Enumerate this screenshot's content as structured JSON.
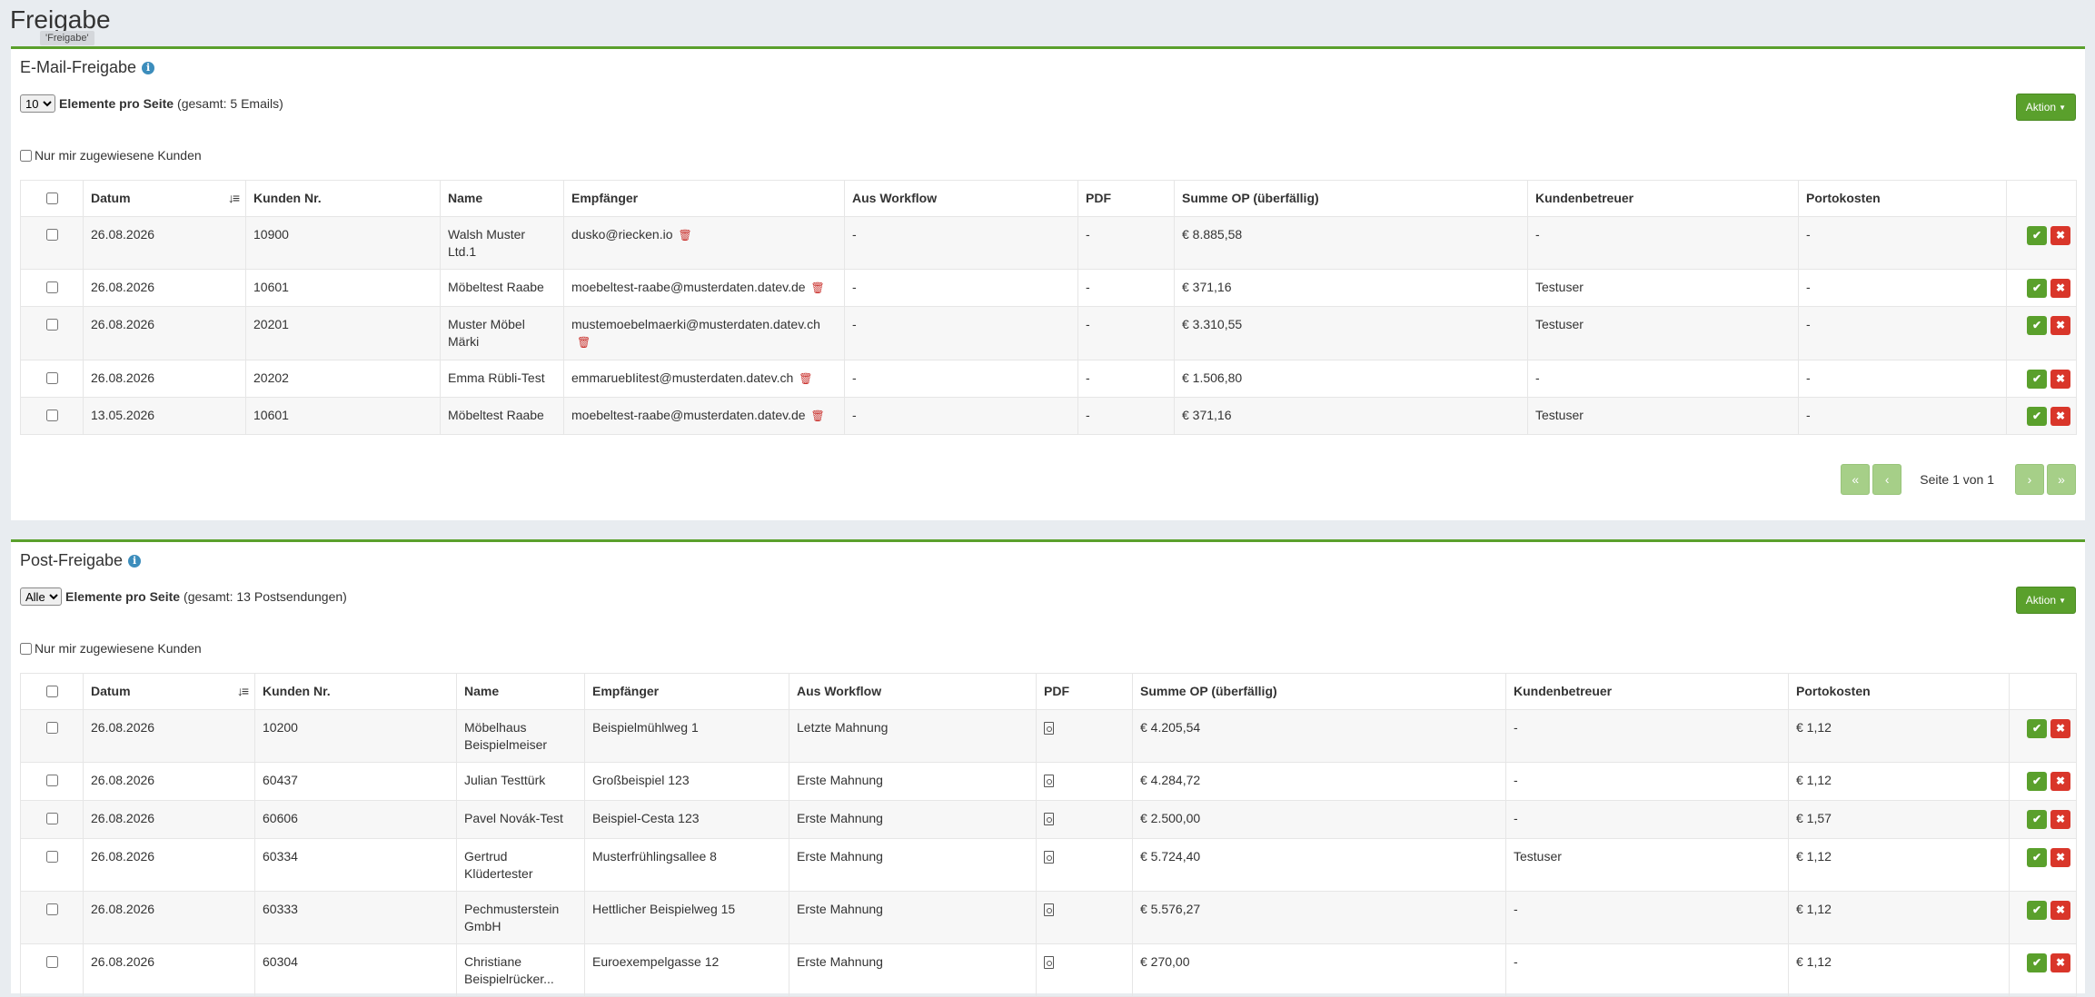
{
  "page": {
    "title": "Freigabe",
    "tooltip": "'Freigabe'"
  },
  "email": {
    "title": "E-Mail-Freigabe",
    "perpage_value": "10",
    "perpage_label": "Elemente pro Seite",
    "total": "(gesamt: 5 Emails)",
    "aktion": "Aktion",
    "mine_label": "Nur mir zugewiesene Kunden",
    "columns": [
      "Datum",
      "Kunden Nr.",
      "Name",
      "Empfänger",
      "Aus Workflow",
      "PDF",
      "Summe OP (überfällig)",
      "Kundenbetreuer",
      "Portokosten"
    ],
    "rows": [
      {
        "datum": "26.08.2026",
        "nr": "10900",
        "name": "Walsh Muster Ltd.1",
        "empf": "dusko@riecken.io",
        "workflow": "-",
        "pdf": "-",
        "summe": "€ 8.885,58",
        "betreuer": "-",
        "porto": "-"
      },
      {
        "datum": "26.08.2026",
        "nr": "10601",
        "name": "Möbeltest Raabe",
        "empf": "moebeltest-raabe@musterdaten.datev.de",
        "workflow": "-",
        "pdf": "-",
        "summe": "€ 371,16",
        "betreuer": "Testuser",
        "porto": "-"
      },
      {
        "datum": "26.08.2026",
        "nr": "20201",
        "name": "Muster Möbel Märki",
        "empf": "mustemoebelmaerki@musterdaten.datev.ch",
        "workflow": "-",
        "pdf": "-",
        "summe": "€ 3.310,55",
        "betreuer": "Testuser",
        "porto": "-"
      },
      {
        "datum": "26.08.2026",
        "nr": "20202",
        "name": "Emma Rübli-Test",
        "empf": "emmaruebIitest@musterdaten.datev.ch",
        "workflow": "-",
        "pdf": "-",
        "summe": "€ 1.506,80",
        "betreuer": "-",
        "porto": "-"
      },
      {
        "datum": "13.05.2026",
        "nr": "10601",
        "name": "Möbeltest Raabe",
        "empf": "moebeltest-raabe@musterdaten.datev.de",
        "workflow": "-",
        "pdf": "-",
        "summe": "€ 371,16",
        "betreuer": "Testuser",
        "porto": "-"
      }
    ],
    "pager": {
      "first": "«",
      "prev": "‹",
      "text": "Seite 1 von 1",
      "next": "›",
      "last": "»"
    }
  },
  "post": {
    "title": "Post-Freigabe",
    "perpage_value": "Alle",
    "perpage_label": "Elemente pro Seite",
    "total": "(gesamt: 13 Postsendungen)",
    "aktion": "Aktion",
    "mine_label": "Nur mir zugewiesene Kunden",
    "columns": [
      "Datum",
      "Kunden Nr.",
      "Name",
      "Empfänger",
      "Aus Workflow",
      "PDF",
      "Summe OP (überfällig)",
      "Kundenbetreuer",
      "Portokosten"
    ],
    "rows": [
      {
        "datum": "26.08.2026",
        "nr": "10200",
        "name": "Möbelhaus Beispielmeiser",
        "empf": "Beispielmühlweg 1",
        "workflow": "Letzte Mahnung",
        "summe": "€ 4.205,54",
        "betreuer": "-",
        "porto": "€ 1,12"
      },
      {
        "datum": "26.08.2026",
        "nr": "60437",
        "name": "Julian Testtürk",
        "empf": "Großbeispiel 123",
        "workflow": "Erste Mahnung",
        "summe": "€ 4.284,72",
        "betreuer": "-",
        "porto": "€ 1,12"
      },
      {
        "datum": "26.08.2026",
        "nr": "60606",
        "name": "Pavel Novák-Test",
        "empf": "Beispiel-Cesta 123",
        "workflow": "Erste Mahnung",
        "summe": "€ 2.500,00",
        "betreuer": "-",
        "porto": "€ 1,57"
      },
      {
        "datum": "26.08.2026",
        "nr": "60334",
        "name": "Gertrud Klüdertester",
        "empf": "Musterfrühlingsallee 8",
        "workflow": "Erste Mahnung",
        "summe": "€ 5.724,40",
        "betreuer": "Testuser",
        "porto": "€ 1,12"
      },
      {
        "datum": "26.08.2026",
        "nr": "60333",
        "name": "Pechmusterstein GmbH",
        "empf": "Hettlicher Beispielweg 15",
        "workflow": "Erste Mahnung",
        "summe": "€ 5.576,27",
        "betreuer": "-",
        "porto": "€ 1,12"
      },
      {
        "datum": "26.08.2026",
        "nr": "60304",
        "name": "Christiane Beispielrücker...",
        "empf": "Euroexempelgasse 12",
        "workflow": "Erste Mahnung",
        "summe": "€ 270,00",
        "betreuer": "-",
        "porto": "€ 1,12"
      }
    ]
  },
  "icons": {
    "info": "info-icon",
    "sort": "sort-icon",
    "trash": "trash-icon",
    "pdf": "pdf-file-icon",
    "approve": "check-icon",
    "reject": "close-icon"
  },
  "colors": {
    "accent": "#5aa02c",
    "danger": "#d9362a",
    "info": "#3c8dbc",
    "background": "#e8ecf0"
  }
}
